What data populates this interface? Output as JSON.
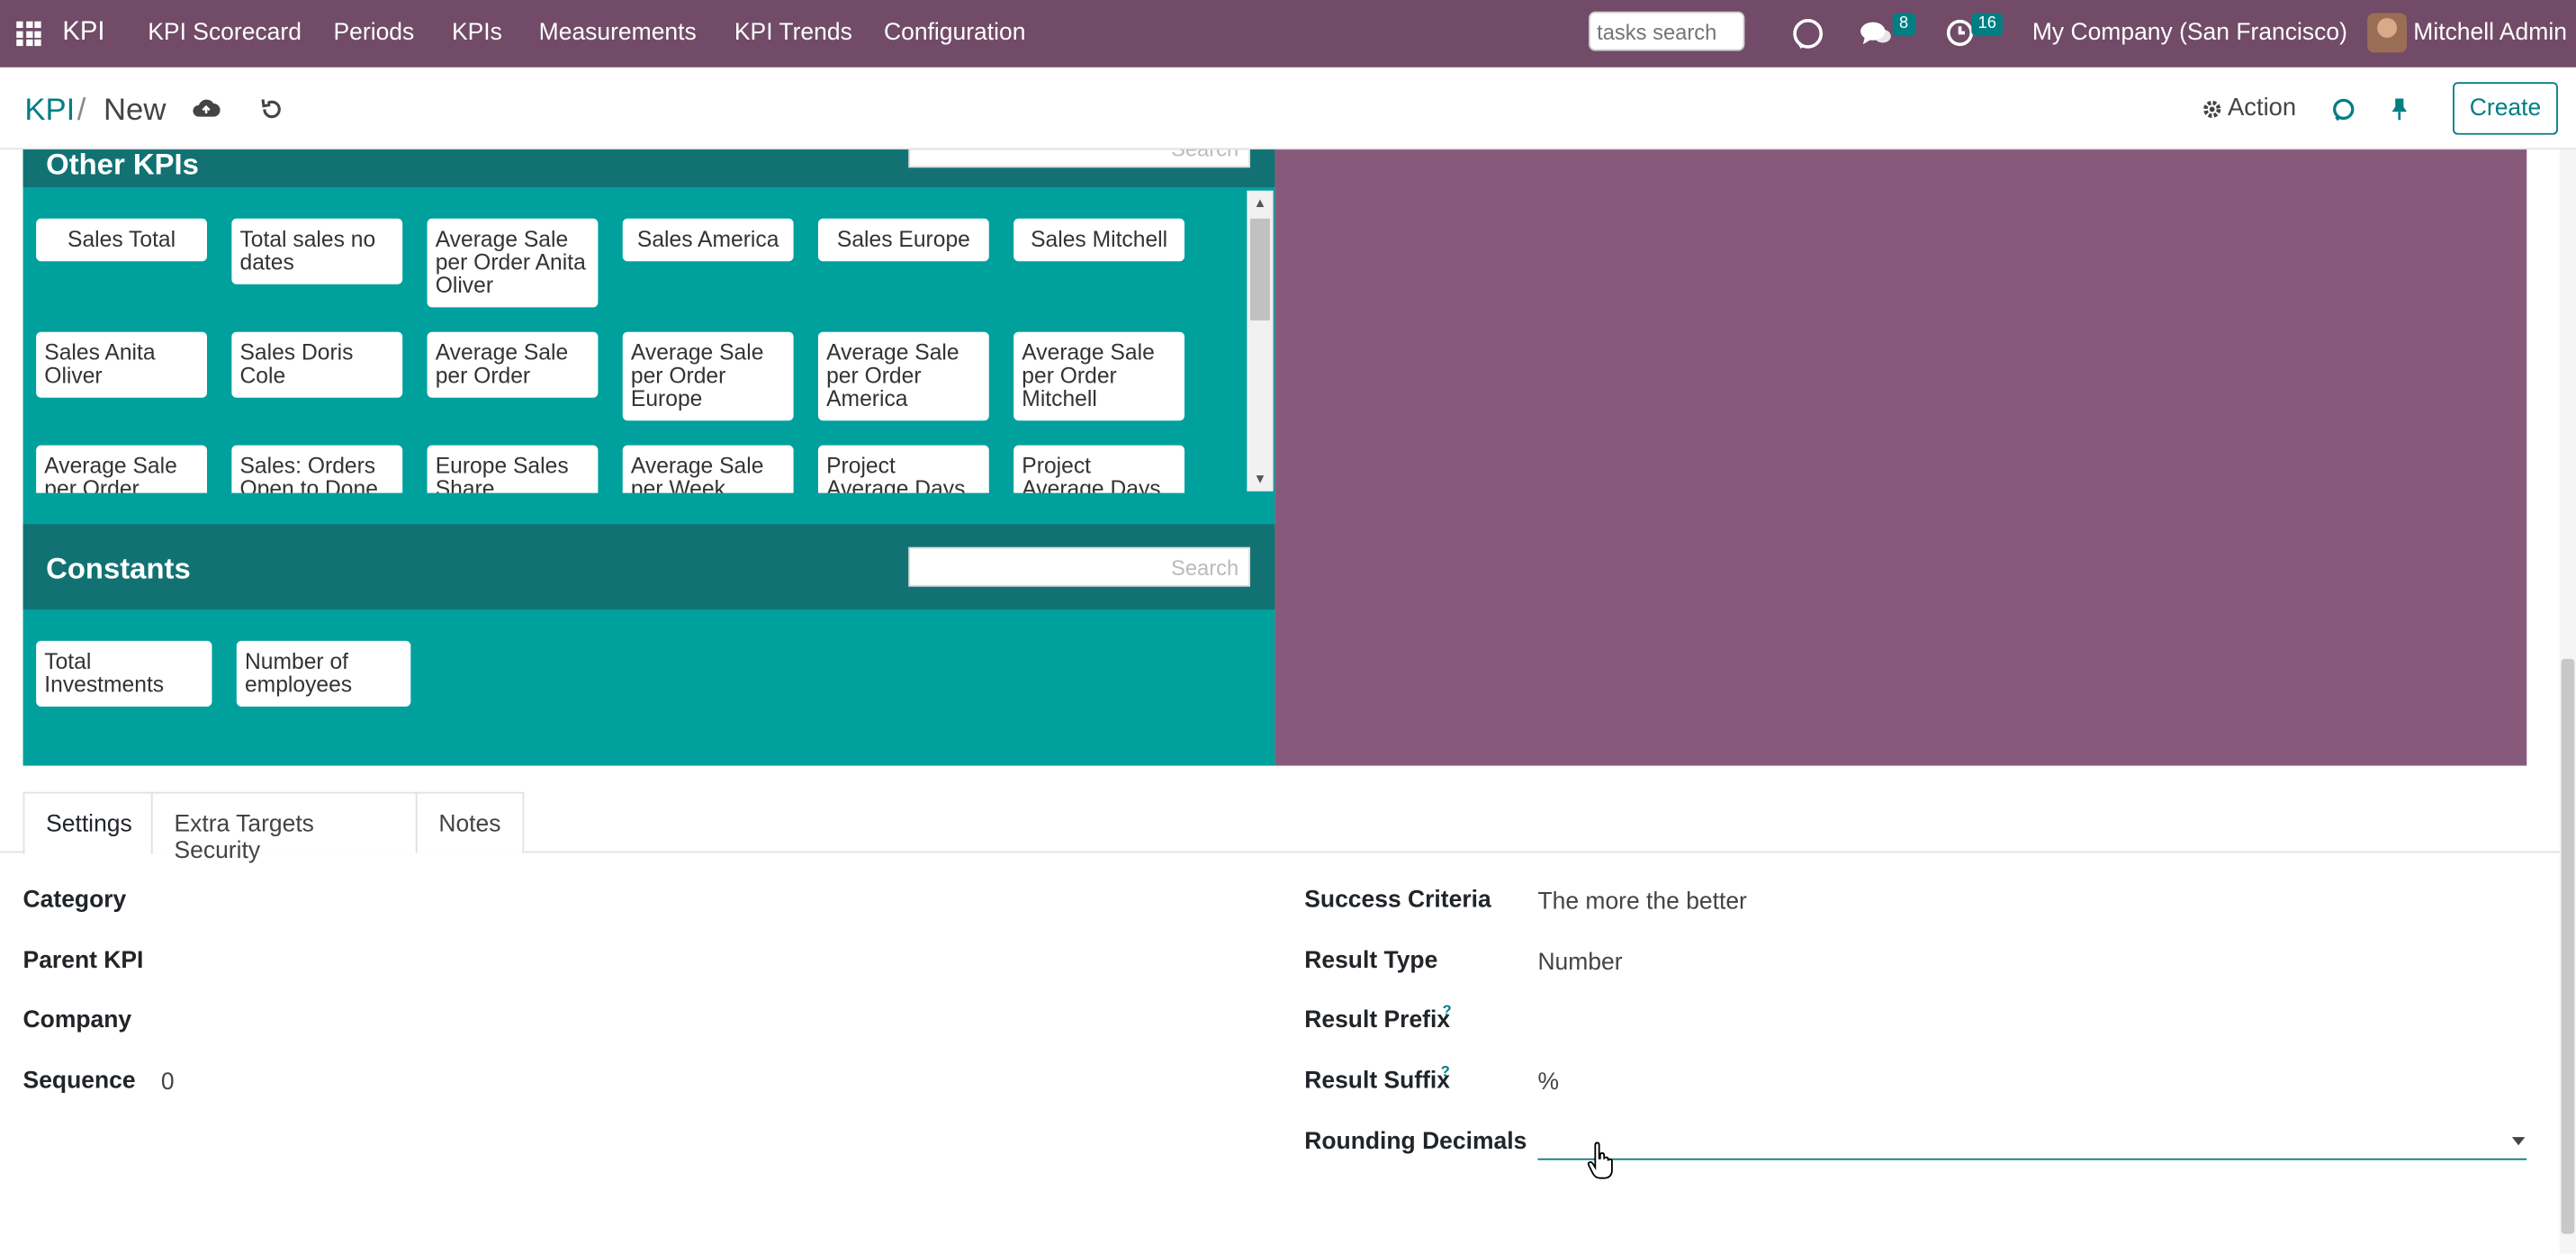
{
  "topbar": {
    "brand": "KPI",
    "menu": [
      "KPI Scorecard",
      "Periods",
      "KPIs",
      "Measurements",
      "KPI Trends",
      "Configuration"
    ],
    "tasks_search_placeholder": "tasks search",
    "messages_count": "8",
    "activities_count": "16",
    "company": "My Company (San Francisco)",
    "user": "Mitchell Admin"
  },
  "control": {
    "breadcrumb_parent": "KPI",
    "breadcrumb_sep": "/",
    "breadcrumb_current": "New",
    "action_label": "Action",
    "create_label": "Create"
  },
  "other_kpis": {
    "title": "Other KPIs",
    "search_placeholder": "Search",
    "tiles": [
      "Sales Total",
      "Total sales no dates",
      "Average Sale per Order Anita Oliver",
      "Sales America",
      "Sales Europe",
      "Sales Mitchell",
      "Sales Anita Oliver",
      "Sales Doris Cole",
      "Average Sale per Order",
      "Average Sale per Order Europe",
      "Average Sale per Order America",
      "Average Sale per Order Mitchell",
      "Average Sale per Order",
      "Sales: Orders Open to Done",
      "Europe Sales Share",
      "Average Sale per Week",
      "Project Average Days",
      "Project Average Days"
    ]
  },
  "constants": {
    "title": "Constants",
    "search_placeholder": "Search",
    "tiles": [
      "Total Investments",
      "Number of employees"
    ]
  },
  "tabs": [
    "Settings",
    "Extra Targets Security",
    "Notes"
  ],
  "fields": {
    "category_label": "Category",
    "parent_kpi_label": "Parent KPI",
    "company_label": "Company",
    "sequence_label": "Sequence",
    "sequence_value": "0",
    "success_criteria_label": "Success Criteria",
    "success_criteria_value": "The more the better",
    "result_type_label": "Result Type",
    "result_type_value": "Number",
    "result_prefix_label": "Result Prefix",
    "result_suffix_label": "Result Suffix",
    "result_suffix_value": "%",
    "rounding_decimals_label": "Rounding Decimals",
    "help_mark": "?"
  },
  "colors": {
    "topbar": "#714b67",
    "accent": "#017e84",
    "teal_panel": "#00a09d",
    "teal_header": "#127273",
    "purple_panel": "#875a7b"
  },
  "icons": [
    "apps-grid-icon",
    "discuss-icon",
    "messages-icon",
    "activity-clock-icon",
    "cloud-save-icon",
    "discard-icon",
    "gear-icon",
    "refresh-icon",
    "pin-icon",
    "hand-cursor-icon"
  ]
}
